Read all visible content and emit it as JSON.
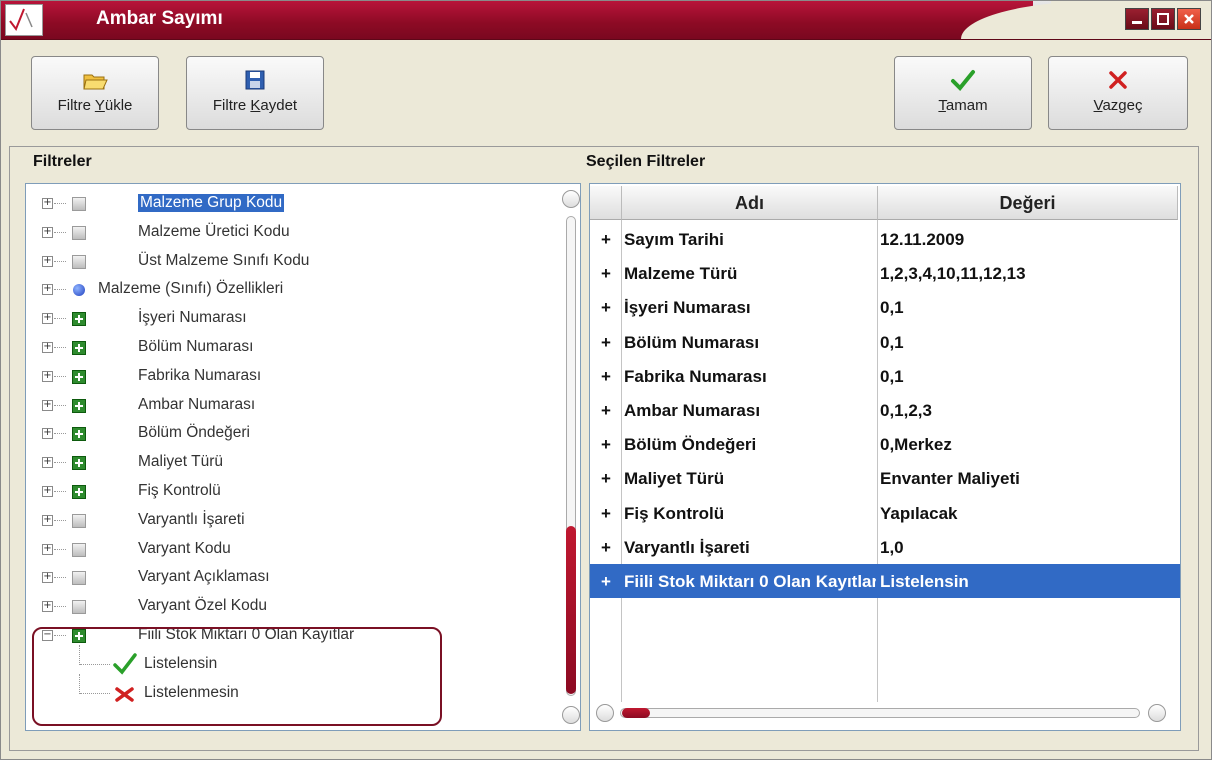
{
  "window": {
    "title": "Ambar Sayımı"
  },
  "toolbar": {
    "load_filter": {
      "prefix": "Filtre ",
      "hotkey": "Y",
      "suffix": "ükle"
    },
    "save_filter": {
      "prefix": "Filtre ",
      "hotkey": "K",
      "suffix": "aydet"
    },
    "ok": {
      "prefix": "",
      "hotkey": "T",
      "suffix": "amam"
    },
    "cancel": {
      "prefix": "",
      "hotkey": "V",
      "suffix": "azgeç"
    }
  },
  "filters_panel": {
    "title": "Filtreler"
  },
  "selected_panel": {
    "title": "Seçilen Filtreler"
  },
  "tree": {
    "items": [
      {
        "label": "Malzeme Grup Kodu",
        "icon": "gray-box"
      },
      {
        "label": "Malzeme Üretici Kodu",
        "icon": "gray-box"
      },
      {
        "label": "Üst Malzeme Sınıfı Kodu",
        "icon": "gray-box"
      },
      {
        "label": "Malzeme (Sınıfı) Özellikleri",
        "icon": "blue-ball"
      },
      {
        "label": "İşyeri  Numarası",
        "icon": "green-plus"
      },
      {
        "label": "Bölüm Numarası",
        "icon": "green-plus"
      },
      {
        "label": "Fabrika Numarası",
        "icon": "green-plus"
      },
      {
        "label": "Ambar Numarası",
        "icon": "green-plus"
      },
      {
        "label": "Bölüm Öndeğeri",
        "icon": "green-plus"
      },
      {
        "label": "Maliyet Türü",
        "icon": "green-plus"
      },
      {
        "label": "Fiş Kontrolü",
        "icon": "green-plus"
      },
      {
        "label": "Varyantlı İşareti",
        "icon": "gray-box"
      },
      {
        "label": "Varyant Kodu",
        "icon": "gray-box"
      },
      {
        "label": "Varyant Açıklaması",
        "icon": "gray-box"
      },
      {
        "label": "Varyant Özel Kodu",
        "icon": "gray-box"
      },
      {
        "label": "Fiili Stok Miktarı 0 Olan Kayıtlar",
        "icon": "green-plus"
      }
    ],
    "children": [
      {
        "label": "Listelensin",
        "icon": "check-icon"
      },
      {
        "label": "Listelenmesin",
        "icon": "cross-icon"
      }
    ]
  },
  "grid": {
    "columns": [
      "Adı",
      "Değeri"
    ],
    "rows": [
      {
        "name": "Sayım Tarihi",
        "value": "12.11.2009"
      },
      {
        "name": "Malzeme Türü",
        "value": "1,2,3,4,10,11,12,13"
      },
      {
        "name": "İşyeri  Numarası",
        "value": "0,1"
      },
      {
        "name": "Bölüm Numarası",
        "value": "0,1"
      },
      {
        "name": "Fabrika Numarası",
        "value": "0,1"
      },
      {
        "name": "Ambar Numarası",
        "value": "0,1,2,3"
      },
      {
        "name": "Bölüm Öndeğeri",
        "value": "0,Merkez"
      },
      {
        "name": "Maliyet Türü",
        "value": "Envanter Maliyeti"
      },
      {
        "name": "Fiş Kontrolü",
        "value": "Yapılacak"
      },
      {
        "name": "Varyantlı İşareti",
        "value": "1,0"
      },
      {
        "name": "Fiili Stok Miktarı 0 Olan Kayıtlar",
        "value": "Listelensin"
      }
    ],
    "expand_symbol": "+"
  },
  "colors": {
    "title_bar": "#8c0a24",
    "selection": "#316ac5",
    "accent_green": "#2e8b2e",
    "accent_red": "#c01830"
  }
}
